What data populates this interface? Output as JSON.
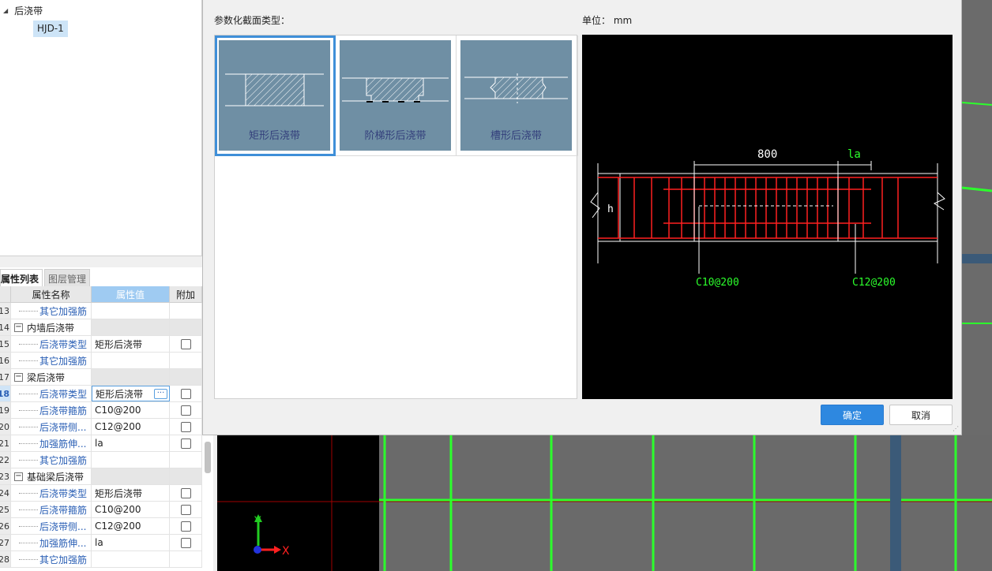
{
  "tree": {
    "root_label": "后浇带",
    "selected_child": "HJD-1"
  },
  "props": {
    "tabs": [
      "属性列表",
      "图层管理"
    ],
    "headers": {
      "name": "属性名称",
      "value": "属性值",
      "extra": "附加"
    },
    "rows": [
      {
        "num": "13",
        "name": "其它加强筋",
        "value": "",
        "group": false,
        "checkbox": false
      },
      {
        "num": "14",
        "name": "内墙后浇带",
        "value": "",
        "group": true,
        "checkbox": false
      },
      {
        "num": "15",
        "name": "后浇带类型",
        "value": "矩形后浇带",
        "group": false,
        "checkbox": true
      },
      {
        "num": "16",
        "name": "其它加强筋",
        "value": "",
        "group": false,
        "checkbox": false
      },
      {
        "num": "17",
        "name": "梁后浇带",
        "value": "",
        "group": true,
        "checkbox": false
      },
      {
        "num": "18",
        "name": "后浇带类型",
        "value": "矩形后浇带",
        "group": false,
        "checkbox": true,
        "selected": true
      },
      {
        "num": "19",
        "name": "后浇带箍筋",
        "value": "C10@200",
        "group": false,
        "checkbox": true
      },
      {
        "num": "20",
        "name": "后浇带侧...",
        "value": "C12@200",
        "group": false,
        "checkbox": true
      },
      {
        "num": "21",
        "name": "加强筋伸...",
        "value": "la",
        "group": false,
        "checkbox": true
      },
      {
        "num": "22",
        "name": "其它加强筋",
        "value": "",
        "group": false,
        "checkbox": false
      },
      {
        "num": "23",
        "name": "基础梁后浇带",
        "value": "",
        "group": true,
        "checkbox": false
      },
      {
        "num": "24",
        "name": "后浇带类型",
        "value": "矩形后浇带",
        "group": false,
        "checkbox": true
      },
      {
        "num": "25",
        "name": "后浇带箍筋",
        "value": "C10@200",
        "group": false,
        "checkbox": true
      },
      {
        "num": "26",
        "name": "后浇带侧...",
        "value": "C12@200",
        "group": false,
        "checkbox": true
      },
      {
        "num": "27",
        "name": "加强筋伸...",
        "value": "la",
        "group": false,
        "checkbox": true
      },
      {
        "num": "28",
        "name": "其它加强筋",
        "value": "",
        "group": false,
        "checkbox": false
      }
    ]
  },
  "dialog": {
    "section_label": "参数化截面类型：",
    "unit_label": "单位： mm",
    "types": [
      "矩形后浇带",
      "阶梯形后浇带",
      "槽形后浇带"
    ],
    "selected_type": "矩形后浇带",
    "preview": {
      "dim_width": "800",
      "dim_extension": "la",
      "height_label": "h",
      "stirrup_label": "C10@200",
      "side_bar_label": "C12@200"
    },
    "ok_label": "确定",
    "cancel_label": "取消"
  },
  "axis": {
    "x": "X",
    "y": "Y"
  },
  "colors": {
    "accent": "#2e88e0",
    "rebar": "#ff2020",
    "cad_green": "#2cff2c",
    "thumb_bg": "#6f8fa4"
  }
}
